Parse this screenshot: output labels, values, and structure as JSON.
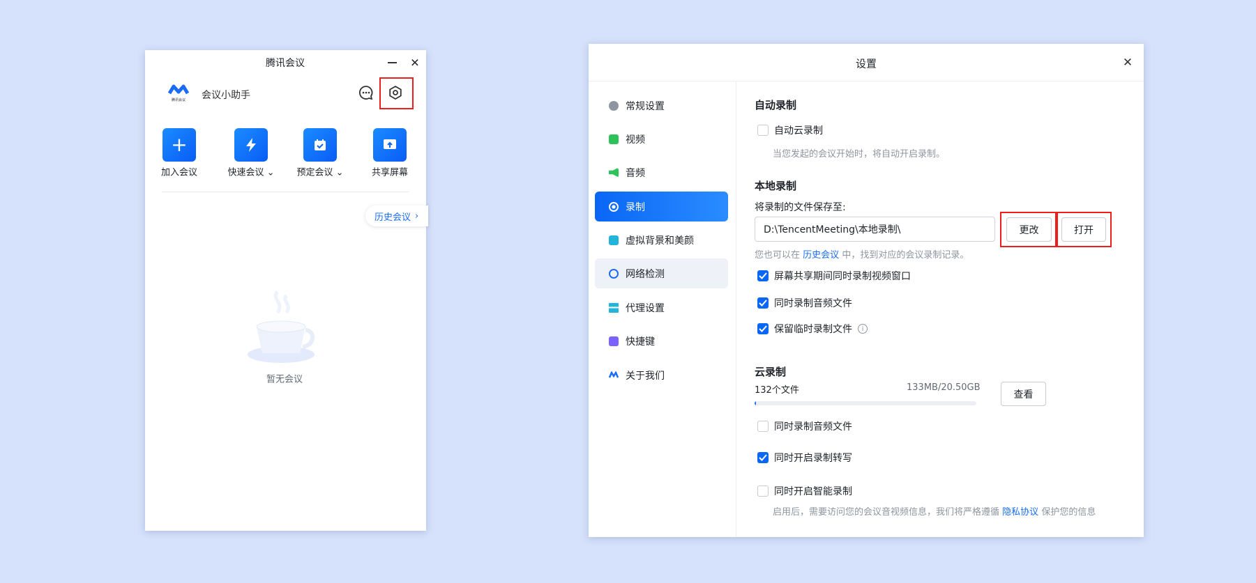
{
  "main_window": {
    "title": "腾讯会议",
    "logo_text": "腾讯会议",
    "assistant": "会议小助手",
    "actions": [
      {
        "label": "加入会议",
        "icon": "plus-icon",
        "dropdown": false
      },
      {
        "label": "快速会议",
        "icon": "lightning-icon",
        "dropdown": true
      },
      {
        "label": "预定会议",
        "icon": "calendar-check-icon",
        "dropdown": true
      },
      {
        "label": "共享屏幕",
        "icon": "share-screen-icon",
        "dropdown": false
      }
    ],
    "history_label": "历史会议",
    "empty_text": "暂无会议"
  },
  "settings": {
    "title": "设置",
    "sidebar": [
      {
        "label": "常规设置",
        "icon": "gear-icon",
        "color": "#8f959e"
      },
      {
        "label": "视频",
        "icon": "camera-icon",
        "color": "#2ec25b"
      },
      {
        "label": "音频",
        "icon": "speaker-icon",
        "color": "#2ec25b"
      },
      {
        "label": "录制",
        "icon": "record-icon",
        "color": "#ffffff"
      },
      {
        "label": "虚拟背景和美颜",
        "icon": "portrait-icon",
        "color": "#23b5d9"
      },
      {
        "label": "网络检测",
        "icon": "globe-icon",
        "color": "#1a6cf5"
      },
      {
        "label": "代理设置",
        "icon": "network-icon",
        "color": "#23b5d9"
      },
      {
        "label": "快捷键",
        "icon": "keyboard-icon",
        "color": "#7b61ff"
      },
      {
        "label": "关于我们",
        "icon": "logo-icon",
        "color": "#1a6cf5"
      }
    ],
    "auto": {
      "heading": "自动录制",
      "cloud_auto": {
        "label": "自动云录制",
        "checked": false
      },
      "desc": "当您发起的会议开始时，将自动开启录制。"
    },
    "local": {
      "heading": "本地录制",
      "save_label": "将录制的文件保存至:",
      "path": "D:\\TencentMeeting\\本地录制\\",
      "change": "更改",
      "open": "打开",
      "hint_pre": "您也可以在",
      "hint_link": "历史会议",
      "hint_post": "中，找到对应的会议录制记录。",
      "options": [
        {
          "label": "屏幕共享期间同时录制视频窗口",
          "checked": true
        },
        {
          "label": "同时录制音频文件",
          "checked": true
        },
        {
          "label": "保留临时录制文件",
          "checked": true
        }
      ]
    },
    "cloud": {
      "heading": "云录制",
      "files": "132个文件",
      "usage": "133MB/20.50GB",
      "usage_fraction": 0.0065,
      "view": "查看",
      "options": [
        {
          "label": "同时录制音频文件",
          "checked": false
        },
        {
          "label": "同时开启录制转写",
          "checked": true
        },
        {
          "label": "同时开启智能录制",
          "checked": false
        }
      ],
      "smart_desc_pre": "启用后，需要访问您的会议音视频信息，我们将严格遵循",
      "smart_desc_link": "隐私协议",
      "smart_desc_post": "保护您的信息"
    }
  }
}
